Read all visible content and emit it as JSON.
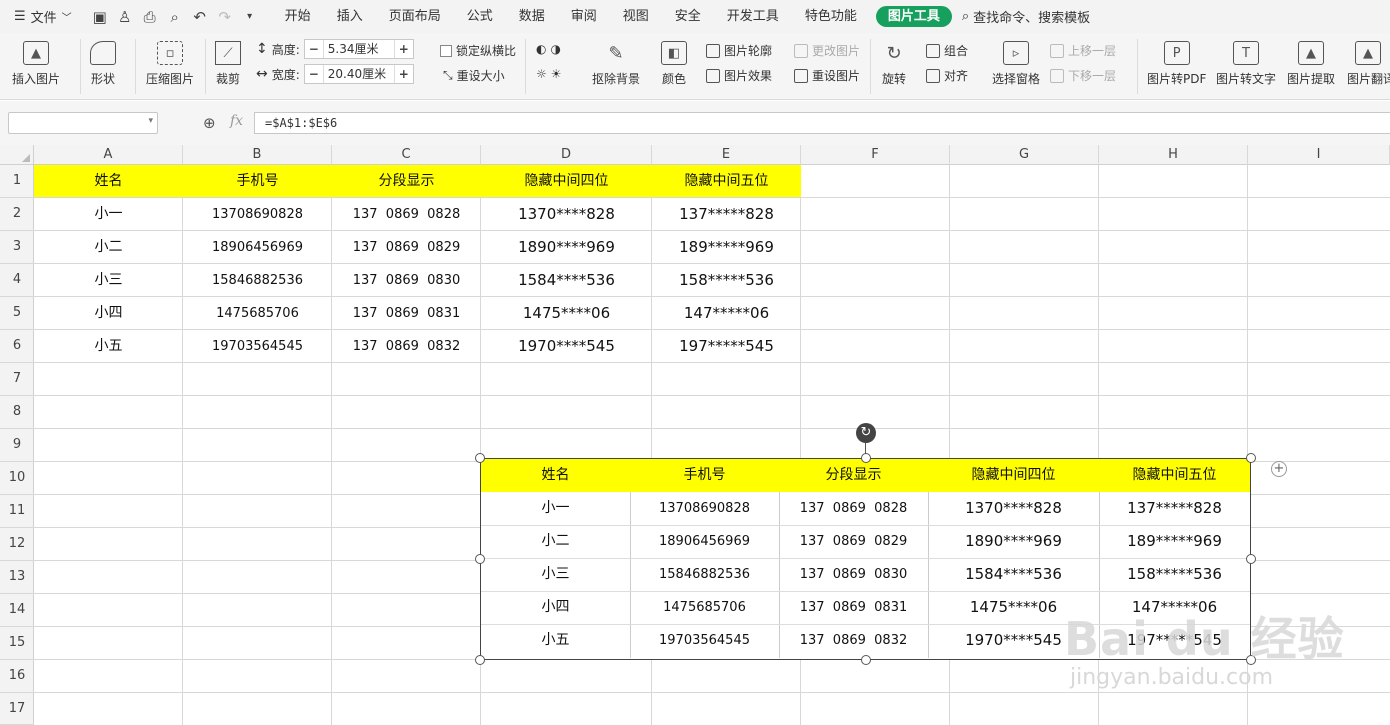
{
  "menubar": {
    "file_label": "文件",
    "tabs": [
      "开始",
      "插入",
      "页面布局",
      "公式",
      "数据",
      "审阅",
      "视图",
      "安全",
      "开发工具",
      "特色功能"
    ],
    "active_tab": "图片工具",
    "search_label": "查找命令、搜索模板"
  },
  "ribbon": {
    "insert_pic": "插入图片",
    "shape": "形状",
    "compress": "压缩图片",
    "crop": "裁剪",
    "height_label": "高度:",
    "height_value": "5.34厘米",
    "width_label": "宽度:",
    "width_value": "20.40厘米",
    "lock_ratio": "锁定纵横比",
    "reset_size": "重设大小",
    "remove_bg": "抠除背景",
    "color": "颜色",
    "outline": "图片轮廓",
    "effect": "图片效果",
    "change_pic": "更改图片",
    "reset_pic": "重设图片",
    "rotate": "旋转",
    "group": "组合",
    "align": "对齐",
    "select_pane": "选择窗格",
    "bring_forward": "上移一层",
    "send_backward": "下移一层",
    "to_pdf": "图片转PDF",
    "to_text": "图片转文字",
    "extract": "图片提取",
    "translate": "图片翻译"
  },
  "formula_bar": {
    "name_box": "",
    "fx": "fx",
    "formula": "=$A$1:$E$6"
  },
  "columns": [
    "A",
    "B",
    "C",
    "D",
    "E",
    "F",
    "G",
    "H",
    "I"
  ],
  "rows": [
    "1",
    "2",
    "3",
    "4",
    "5",
    "6",
    "7",
    "8",
    "9",
    "10",
    "11",
    "12",
    "13",
    "14",
    "15",
    "16",
    "17"
  ],
  "table": {
    "headers": [
      "姓名",
      "手机号",
      "分段显示",
      "隐藏中间四位",
      "隐藏中间五位"
    ],
    "rows": [
      [
        "小一",
        "13708690828",
        "137  0869  0828",
        "1370****828",
        "137*****828"
      ],
      [
        "小二",
        "18906456969",
        "137  0869  0829",
        "1890****969",
        "189*****969"
      ],
      [
        "小三",
        "15846882536",
        "137  0869  0830",
        "1584****536",
        "158*****536"
      ],
      [
        "小四",
        "1475685706",
        "137  0869  0831",
        "1475****06",
        "147*****06"
      ],
      [
        "小五",
        "19703564545",
        "137  0869  0832",
        "1970****545",
        "197*****545"
      ]
    ]
  },
  "watermark": {
    "brand": "Bai du 经验",
    "url": "jingyan.baidu.com"
  },
  "colors": {
    "accent": "#17a05d",
    "highlight": "#ffff00"
  }
}
